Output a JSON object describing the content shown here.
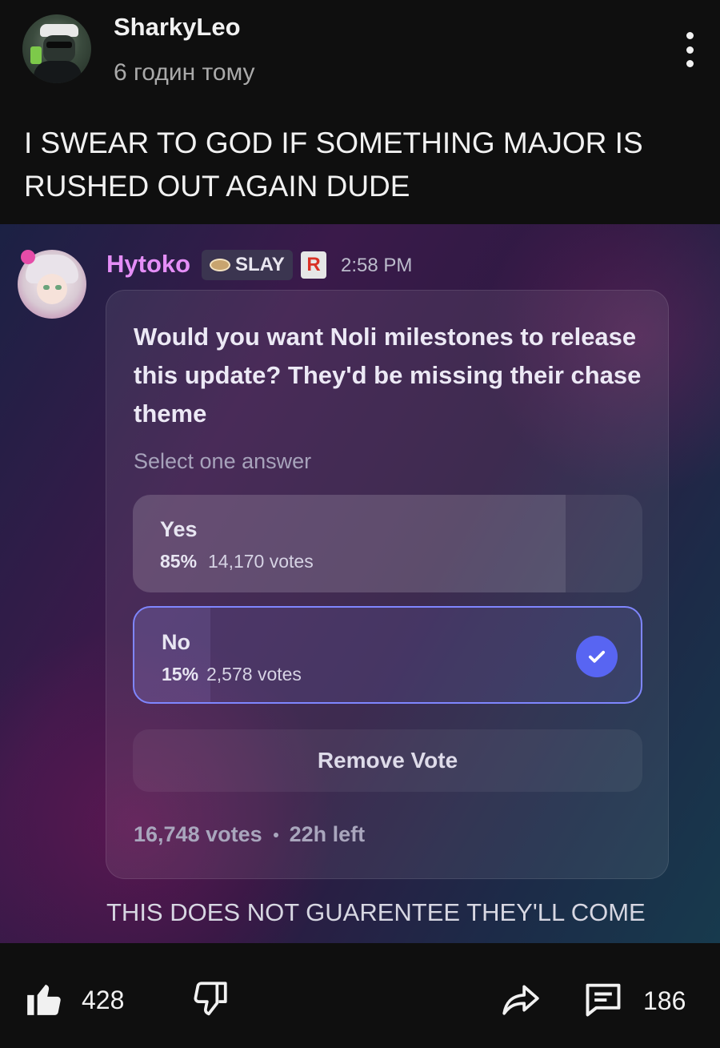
{
  "post": {
    "author": "SharkyLeo",
    "timestamp": "6 годин тому",
    "text": "I SWEAR TO GOD IF SOMETHING MAJOR IS RUSHED OUT AGAIN DUDE"
  },
  "screenshot": {
    "author": "Hytoko",
    "tag_label": "SLAY",
    "time": "2:58 PM",
    "poll": {
      "question": "Would you want Noli milestones to release this update? They'd be missing their chase theme",
      "hint": "Select one answer",
      "options": [
        {
          "label": "Yes",
          "percent": "85%",
          "votes": "14,170 votes",
          "fraction": 0.85,
          "selected": false
        },
        {
          "label": "No",
          "percent": "15%",
          "votes": "2,578 votes",
          "fraction": 0.15,
          "selected": true
        }
      ],
      "remove_label": "Remove Vote",
      "total_votes": "16,748 votes",
      "time_left": "22h left"
    },
    "caption": "THIS DOES NOT GUARENTEE THEY'LL COME"
  },
  "actions": {
    "likes": "428",
    "comments": "186",
    "icons": [
      "like-icon",
      "dislike-icon",
      "share-icon",
      "comments-icon"
    ]
  },
  "colors": {
    "accent": "#5865f2",
    "username_pink": "#e58ef7"
  }
}
